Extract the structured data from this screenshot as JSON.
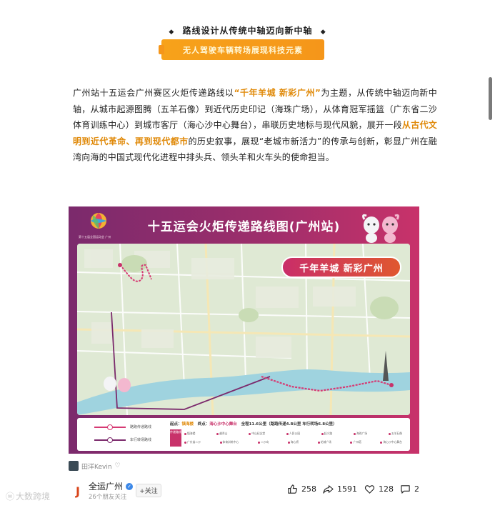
{
  "section_title": {
    "diamond_left": "◆",
    "text": "路线设计从传统中轴迈向新中轴",
    "diamond_right": "◆"
  },
  "banner": {
    "text": "无人驾驶车辆转场展现科技元素"
  },
  "article": {
    "p1_a": "广州站十五运会广州赛区火炬传递路线以",
    "p1_hl1": "“千年羊城 新彩广州”",
    "p1_b": "为主题，从传统中轴迈向新中轴，从城市起源图腾（五羊石像）到近代历史印记（海珠广场），从体育冠军摇篮（广东省二沙体育训练中心）到城市客厅（海心沙中心舞台），串联历史地标与现代风貌，展开一段",
    "p1_hl2": "从古代文明到近代革命、再到现代都市",
    "p1_c": "的历史叙事，展现“老城市新活力”的传承与创新，彰显广州在融湾向海的中国式现代化进程中排头兵、领头羊和火车头的使命担当。"
  },
  "poster": {
    "title": "十五运会火炬传递路线图(广州站)",
    "logo_caption": "第十五届全国运动会 广州",
    "slogan": "千年羊城  新彩广州",
    "legend": {
      "walk": "路跑传递路线",
      "drive": "车行转场路线",
      "start_label": "起点：",
      "start": "镇海楼",
      "end_label": "终点：",
      "end": "海心沙中心舞台",
      "total": "全程11.6公里（路跑传递4.8公里  车行转场6.8公里）",
      "tag": "传递路线",
      "row1": [
        "镇海楼",
        "越秀山",
        "中山纪念堂",
        "人民公园",
        "起义路",
        "海珠广场",
        "五羊石像"
      ],
      "row2": [
        "广东省二沙",
        "体育训练中心",
        "二沙岛",
        "海心桥",
        "花城广场",
        "广州塔",
        "海心沙中心舞台"
      ]
    },
    "colors": {
      "walk": "#d63a73",
      "drive": "#7b2a6c"
    }
  },
  "author": {
    "name": "田洋Kevin",
    "heart": "♡"
  },
  "account": {
    "name": "全运广州",
    "sub": "26个朋友关注",
    "follow": "+关注",
    "logo_letter": "J"
  },
  "stats": {
    "likes": "258",
    "shares": "1591",
    "favorites": "128",
    "comments": "2"
  },
  "watermark": {
    "text": "大数跨境",
    "icon": "ⓦ"
  }
}
